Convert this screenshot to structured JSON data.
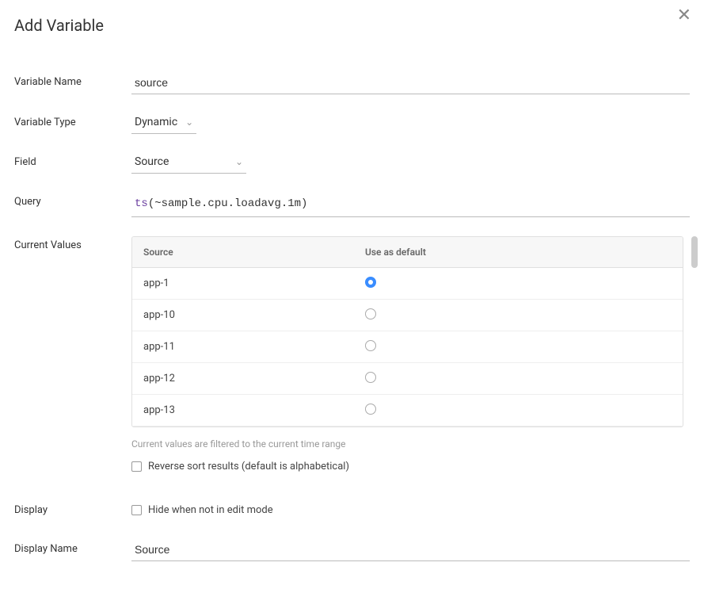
{
  "title": "Add Variable",
  "labels": {
    "variable_name": "Variable Name",
    "variable_type": "Variable Type",
    "field": "Field",
    "query": "Query",
    "current_values": "Current Values",
    "display": "Display",
    "display_name": "Display Name"
  },
  "fields": {
    "variable_name": "source",
    "variable_type": "Dynamic",
    "field": "Source",
    "display_name": "Source"
  },
  "query": {
    "fn": "ts",
    "arg": "(~sample.cpu.loadavg.1m)"
  },
  "table": {
    "header_source": "Source",
    "header_default": "Use as default",
    "rows": [
      {
        "source": "app-1",
        "default": true
      },
      {
        "source": "app-10",
        "default": false
      },
      {
        "source": "app-11",
        "default": false
      },
      {
        "source": "app-12",
        "default": false
      },
      {
        "source": "app-13",
        "default": false
      }
    ]
  },
  "hints": {
    "filtered": "Current values are filtered to the current time range"
  },
  "checkboxes": {
    "reverse_sort": "Reverse sort results (default is alphabetical)",
    "hide_edit": "Hide when not in edit mode"
  }
}
